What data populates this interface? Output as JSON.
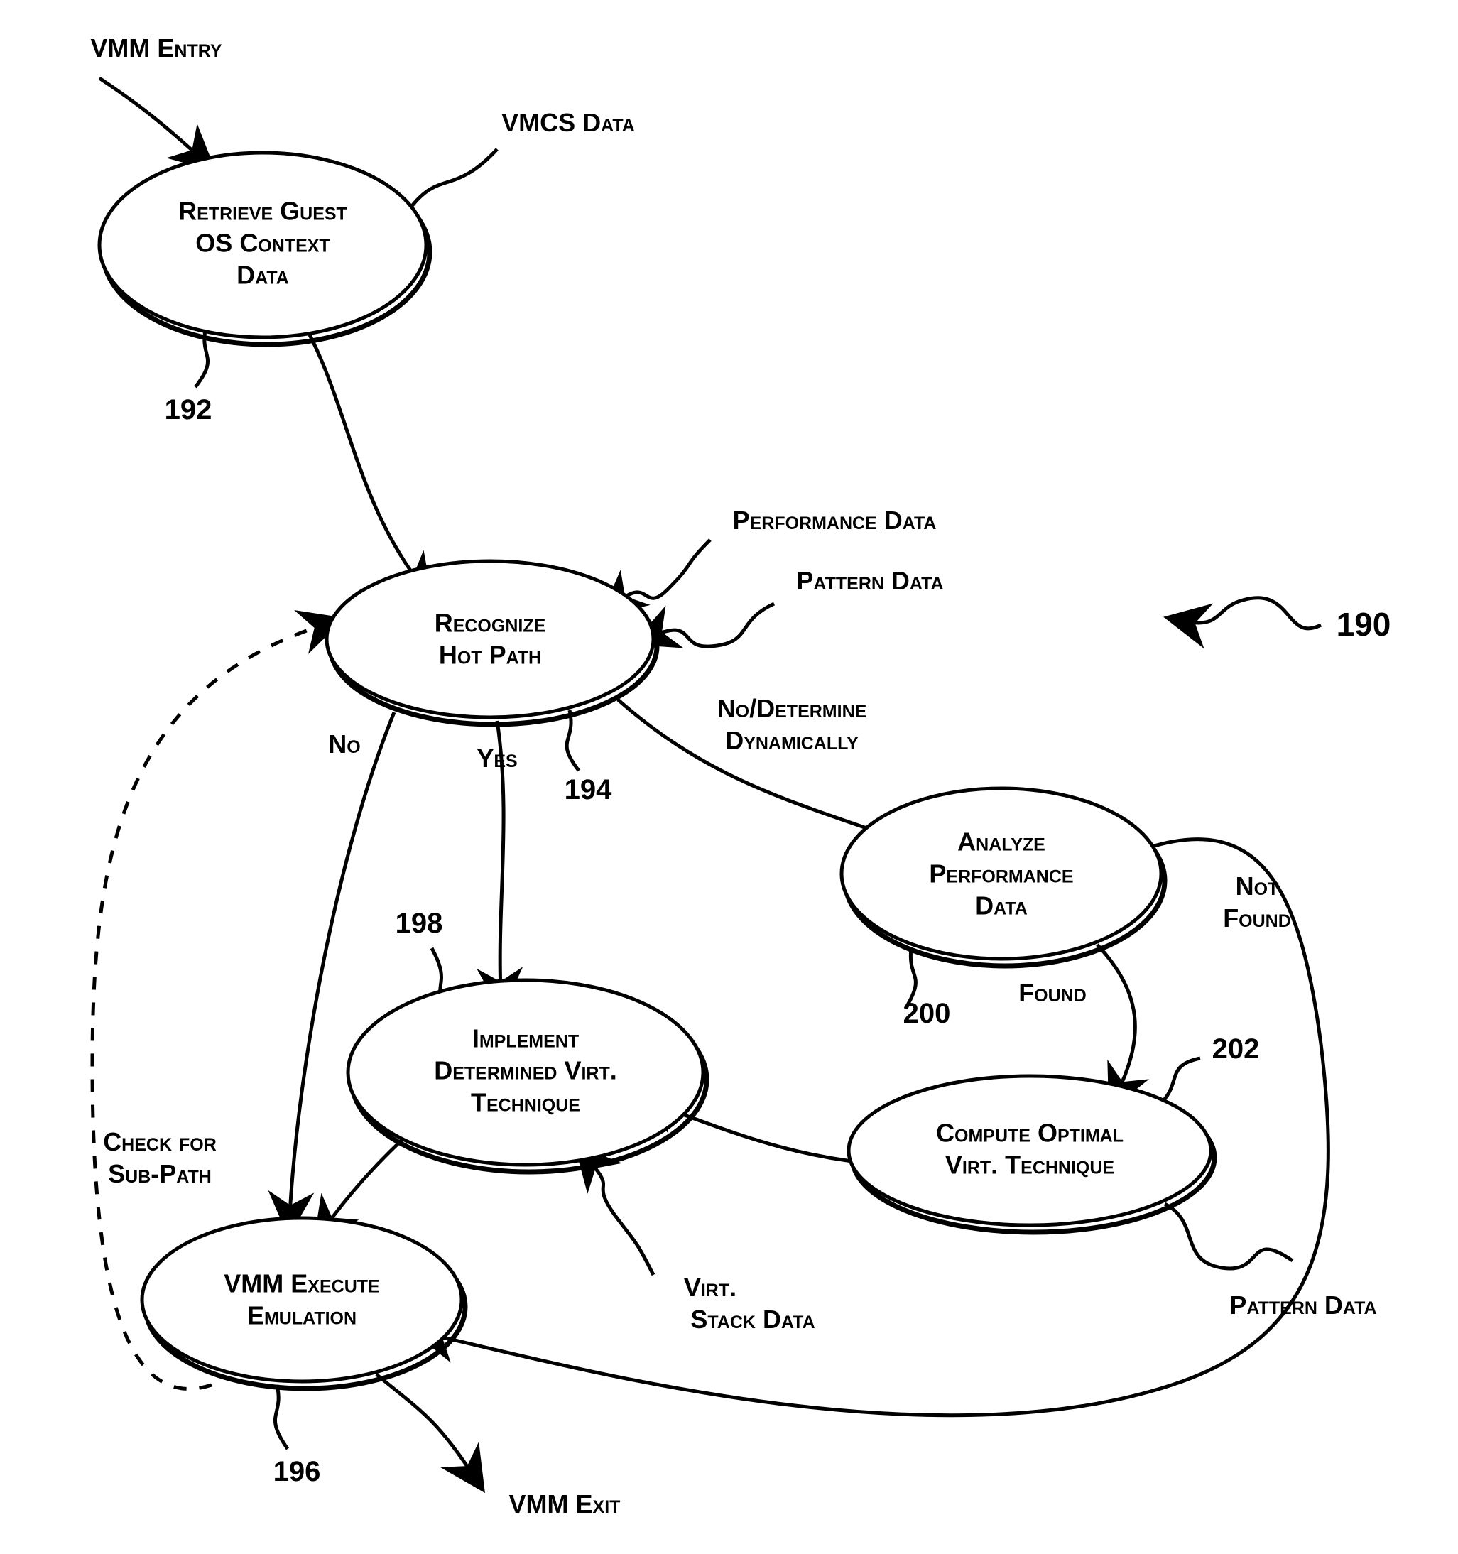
{
  "nodes": {
    "retrieve": {
      "l1": "Retrieve Guest",
      "l2": "OS Context",
      "l3": "Data",
      "ref": "192"
    },
    "recognize": {
      "l1": "Recognize",
      "l2": "Hot Path",
      "ref": "194"
    },
    "implement": {
      "l1": "Implement",
      "l2": "Determined Virt.",
      "l3": "Technique",
      "ref": "198"
    },
    "analyze": {
      "l1": "Analyze",
      "l2": "Performance",
      "l3": "Data",
      "ref": "200"
    },
    "compute": {
      "l1": "Compute Optimal",
      "l2": "Virt. Technique",
      "ref": "202"
    },
    "execute": {
      "l1": "VMM Execute",
      "l2": "Emulation",
      "ref": "196"
    }
  },
  "labels": {
    "vmm_entry": "VMM Entry",
    "vmcs_data": "VMCS Data",
    "performance_data": "Performance Data",
    "pattern_data_in": "Pattern Data",
    "no": "No",
    "yes": "Yes",
    "no_determine_l1": "No/Determine",
    "no_determine_l2": "Dynamically",
    "found": "Found",
    "not_found_l1": "Not",
    "not_found_l2": "Found",
    "check_sub_l1": "Check for",
    "check_sub_l2": "Sub-Path",
    "virt_stack_l1": "Virt.",
    "virt_stack_l2": "Stack Data",
    "pattern_data_out": "Pattern Data",
    "vmm_exit": "VMM Exit",
    "figure_ref": "190"
  }
}
